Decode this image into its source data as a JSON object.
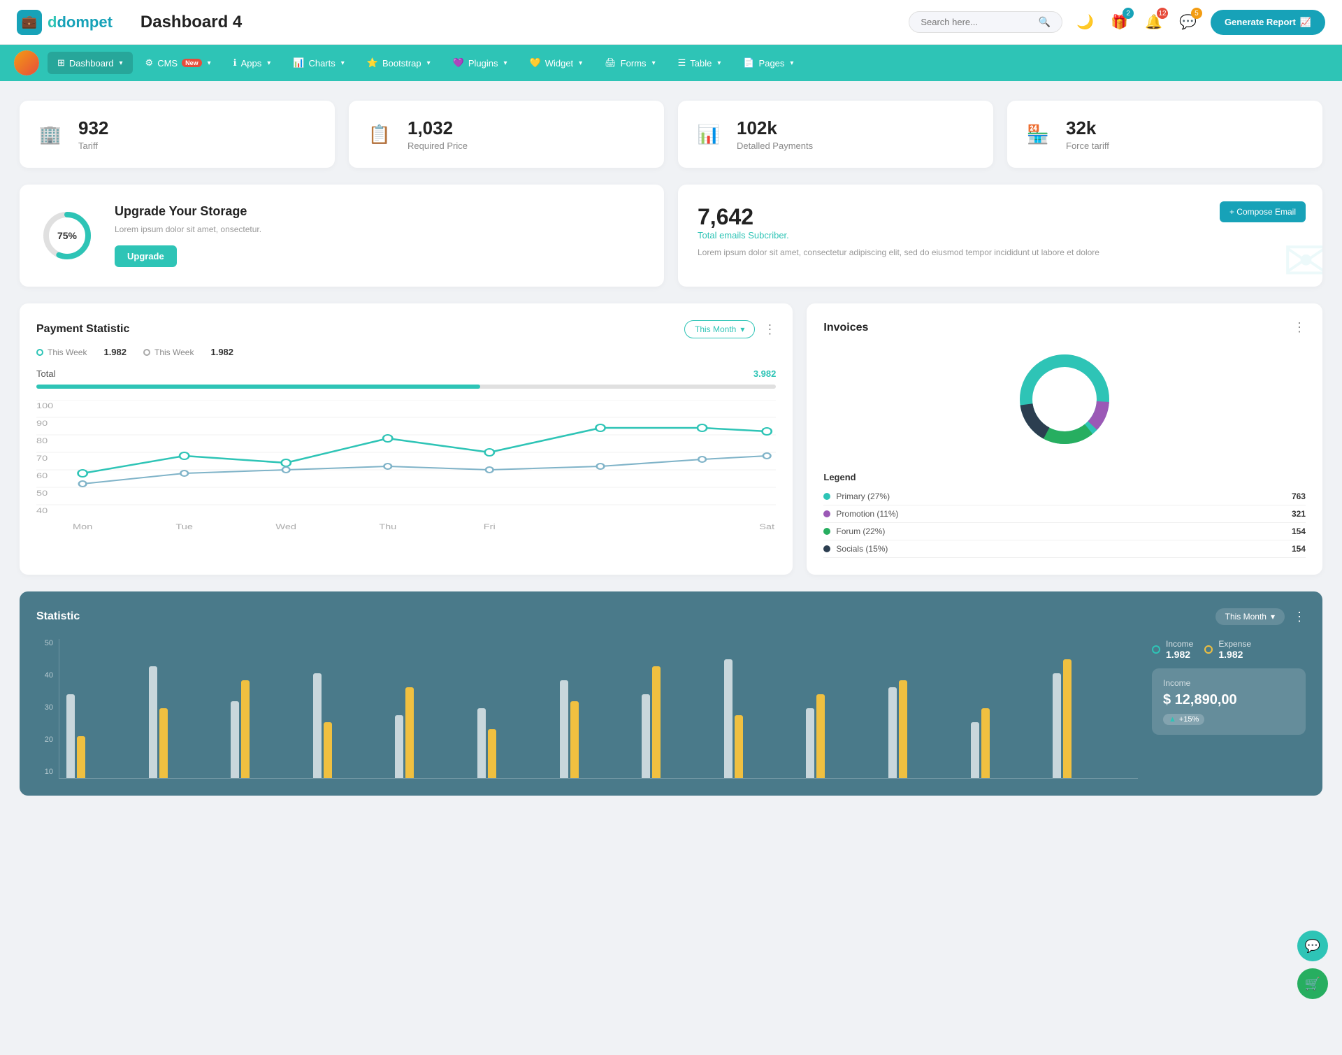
{
  "header": {
    "logo_icon": "💼",
    "logo_name": "dompet",
    "page_title": "Dashboard 4",
    "search_placeholder": "Search here...",
    "generate_btn": "Generate Report",
    "icons": {
      "search": "🔍",
      "moon": "🌙",
      "gift_count": "2",
      "bell_count": "12",
      "chat_count": "5"
    }
  },
  "nav": {
    "items": [
      {
        "label": "Dashboard",
        "icon": "⊞",
        "active": true,
        "has_arrow": true
      },
      {
        "label": "CMS",
        "icon": "⚙",
        "badge_new": true,
        "has_arrow": true
      },
      {
        "label": "Apps",
        "icon": "ℹ",
        "has_arrow": true
      },
      {
        "label": "Charts",
        "icon": "📊",
        "has_arrow": true
      },
      {
        "label": "Bootstrap",
        "icon": "⭐",
        "has_arrow": true
      },
      {
        "label": "Plugins",
        "icon": "💜",
        "has_arrow": true
      },
      {
        "label": "Widget",
        "icon": "💛",
        "has_arrow": true
      },
      {
        "label": "Forms",
        "icon": "🖨",
        "has_arrow": true
      },
      {
        "label": "Table",
        "icon": "☰",
        "has_arrow": true
      },
      {
        "label": "Pages",
        "icon": "📄",
        "has_arrow": true
      }
    ]
  },
  "stat_cards": [
    {
      "value": "932",
      "label": "Tariff",
      "icon": "🏢",
      "icon_color": "#17a2b8"
    },
    {
      "value": "1,032",
      "label": "Required Price",
      "icon": "📋",
      "icon_color": "#e74c3c"
    },
    {
      "value": "102k",
      "label": "Detalled Payments",
      "icon": "📊",
      "icon_color": "#8e44ad"
    },
    {
      "value": "32k",
      "label": "Force tariff",
      "icon": "🏪",
      "icon_color": "#e91e63"
    }
  ],
  "storage": {
    "percent": 75,
    "title": "Upgrade Your Storage",
    "desc": "Lorem ipsum dolor sit amet, onsectetur.",
    "btn_label": "Upgrade"
  },
  "email": {
    "value": "7,642",
    "subtitle": "Total emails Subcriber.",
    "desc": "Lorem ipsum dolor sit amet, consectetur adipiscing elit, sed do eiusmod tempor incididunt ut labore et dolore",
    "compose_btn": "+ Compose Email"
  },
  "payment": {
    "title": "Payment Statistic",
    "filter": "This Month",
    "legend1_label": "This Week",
    "legend1_val": "1.982",
    "legend2_label": "This Week",
    "legend2_val": "1.982",
    "total_label": "Total",
    "total_val": "3.982",
    "progress_pct": 60,
    "x_labels": [
      "Mon",
      "Tue",
      "Wed",
      "Thu",
      "Fri",
      "Sat"
    ],
    "line1_points": "40,160 120,145 230,130 340,110 460,135 560,100 660,100 760,105",
    "line2_points": "40,140 120,150 230,155 340,150 460,145 560,148 660,135 760,110"
  },
  "invoices": {
    "title": "Invoices",
    "legend": [
      {
        "label": "Primary (27%)",
        "color": "#2ec4b6",
        "value": "763"
      },
      {
        "label": "Promotion (11%)",
        "color": "#9b59b6",
        "value": "321"
      },
      {
        "label": "Forum (22%)",
        "color": "#27ae60",
        "value": "154"
      },
      {
        "label": "Socials (15%)",
        "color": "#2c3e50",
        "value": "154"
      }
    ]
  },
  "statistic": {
    "title": "Statistic",
    "filter": "This Month",
    "income_label": "Income",
    "income_val": "1.982",
    "expense_label": "Expense",
    "expense_val": "1.982",
    "income_box_label": "Income",
    "income_amount": "$ 12,890,00",
    "income_badge": "+15%",
    "y_labels": [
      "50",
      "40",
      "30",
      "20",
      "10"
    ],
    "bars": [
      {
        "white": 60,
        "yellow": 30
      },
      {
        "white": 80,
        "yellow": 50
      },
      {
        "white": 55,
        "yellow": 70
      },
      {
        "white": 75,
        "yellow": 40
      },
      {
        "white": 45,
        "yellow": 65
      },
      {
        "white": 50,
        "yellow": 35
      },
      {
        "white": 70,
        "yellow": 55
      },
      {
        "white": 60,
        "yellow": 80
      },
      {
        "white": 85,
        "yellow": 45
      },
      {
        "white": 50,
        "yellow": 60
      },
      {
        "white": 65,
        "yellow": 70
      },
      {
        "white": 40,
        "yellow": 50
      },
      {
        "white": 75,
        "yellow": 85
      }
    ]
  },
  "colors": {
    "primary": "#2ec4b6",
    "secondary": "#17a2b8",
    "nav_bg": "#2ec4b6",
    "stat_bg": "#4a7a8a"
  }
}
